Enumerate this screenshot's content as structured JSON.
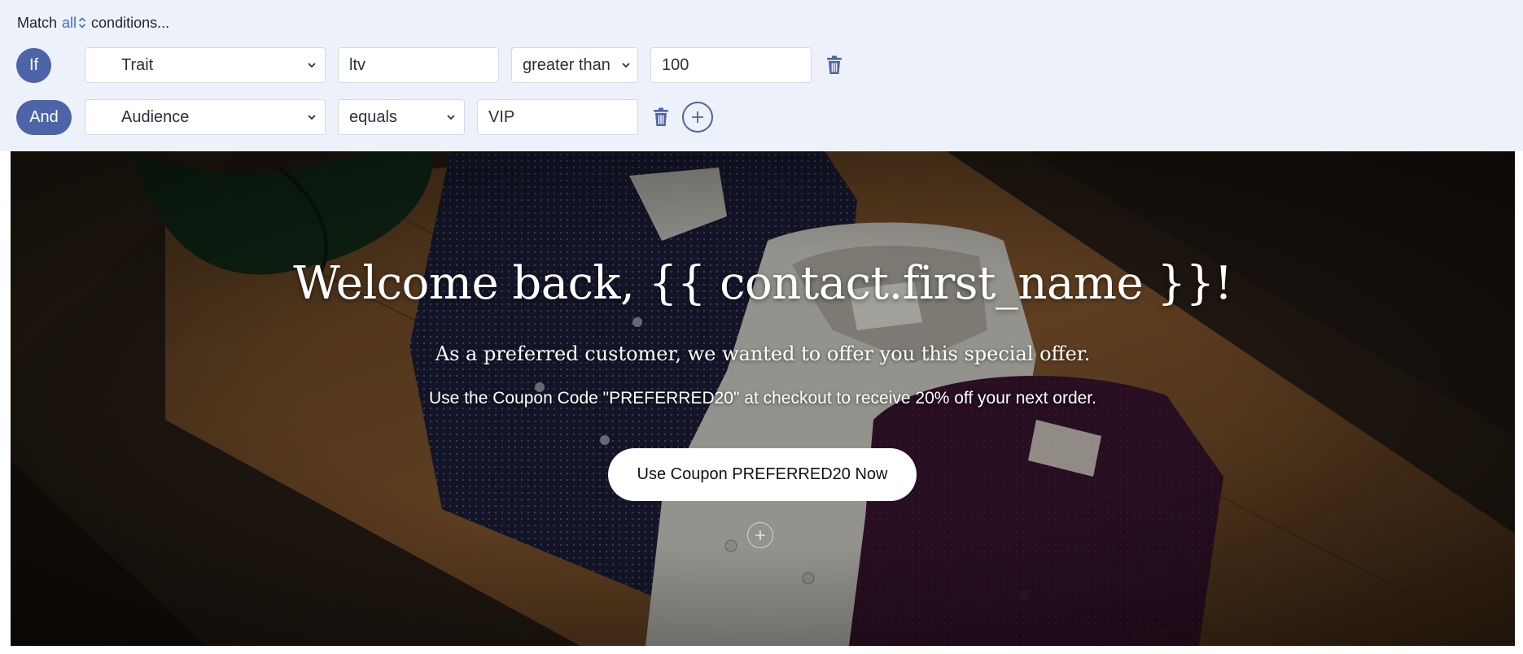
{
  "builder": {
    "match_prefix": "Match",
    "match_mode": "all",
    "match_suffix": "conditions...",
    "rows": [
      {
        "connector": "If",
        "field": "Trait",
        "key": "ltv",
        "operator": "greater than",
        "value": "100"
      },
      {
        "connector": "And",
        "field": "Audience",
        "operator": "equals",
        "value": "VIP"
      }
    ],
    "icons": {
      "delete": "trash-icon",
      "add": "plus-circle-icon",
      "dropdown": "chevron-down-icon",
      "mode": "up-down-icon"
    },
    "accent": "#4e64a8",
    "link_color": "#3b6fd6"
  },
  "hero": {
    "title": "Welcome back, {{ contact.first_name }}!",
    "subtitle": "As a preferred customer, we wanted to offer you this special offer.",
    "body": "Use the Coupon Code \"PREFERRED20\" at checkout to receive 20% off your next order.",
    "cta": "Use Coupon PREFERRED20 Now"
  }
}
